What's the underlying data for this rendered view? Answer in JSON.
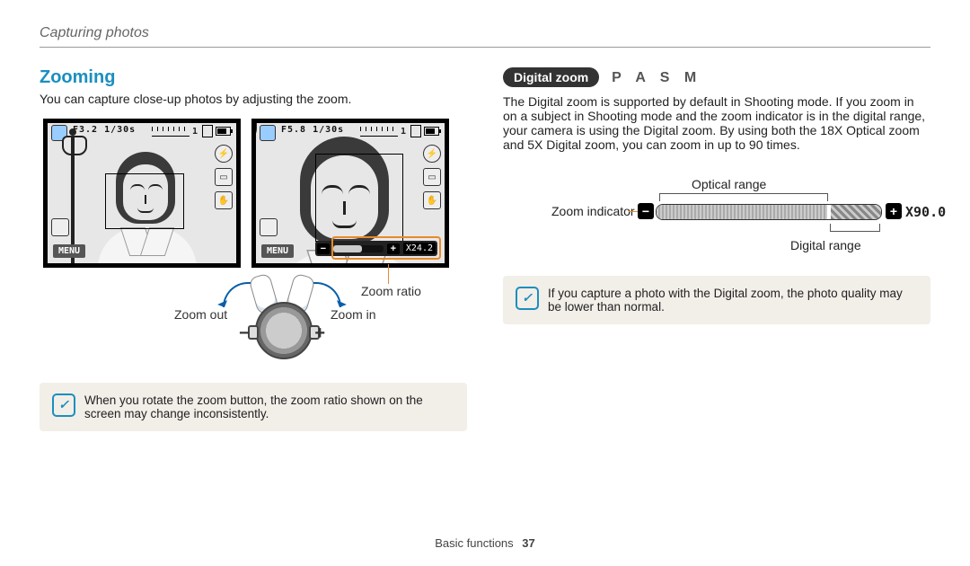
{
  "breadcrumb": "Capturing photos",
  "left": {
    "heading": "Zooming",
    "intro": "You can capture close-up photos by adjusting the zoom.",
    "preview1": {
      "aperture_shutter": "F3.2 1/30s",
      "shots": "1",
      "menu": "MENU"
    },
    "preview2": {
      "aperture_shutter": "F5.8 1/30s",
      "shots": "1",
      "menu": "MENU",
      "zoom_ratio": "X24.2"
    },
    "callouts": {
      "zoom_out": "Zoom out",
      "zoom_in": "Zoom in",
      "zoom_ratio": "Zoom ratio"
    },
    "note": "When you rotate the zoom button, the zoom ratio shown on the screen may change inconsistently."
  },
  "right": {
    "pill": "Digital zoom",
    "modes": "P A S M",
    "body": "The Digital zoom is supported by default in Shooting mode. If you zoom in on a subject in Shooting mode and the zoom indicator is in the digital range, your camera is using the Digital zoom. By using both the 18X Optical zoom and 5X Digital zoom, you can zoom in up to 90 times.",
    "gauge": {
      "optical": "Optical range",
      "indicator": "Zoom indicator",
      "digital": "Digital range",
      "value": "X90.0"
    },
    "note": "If you capture a photo with the Digital zoom, the photo quality may be lower than normal."
  },
  "footer": {
    "section": "Basic functions",
    "page": "37"
  }
}
